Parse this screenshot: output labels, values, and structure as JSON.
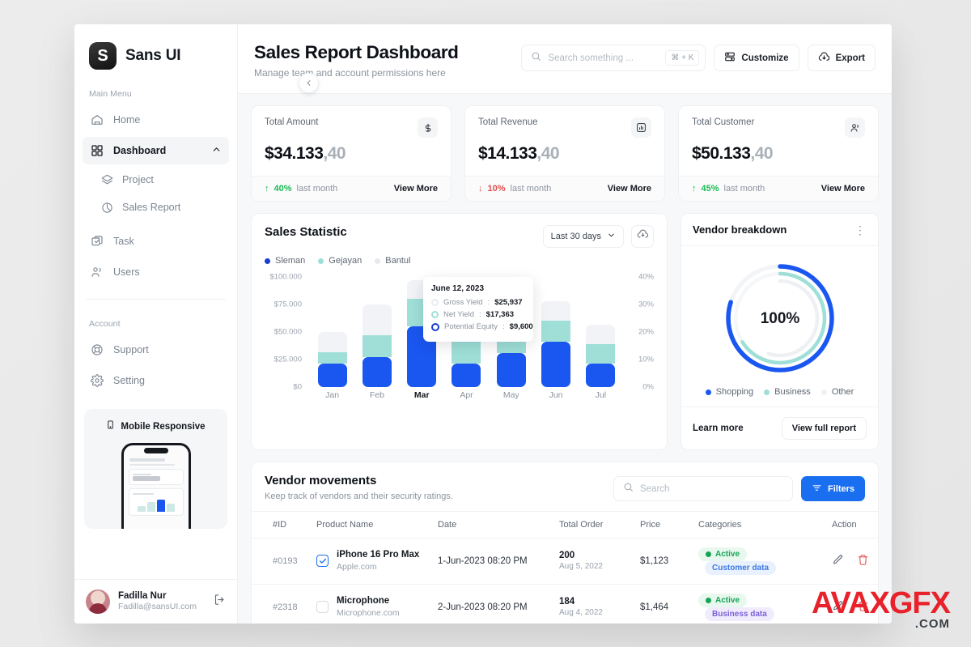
{
  "brand": {
    "logo_letter": "S",
    "name": "Sans UI"
  },
  "sidebar": {
    "main_label": "Main Menu",
    "account_label": "Account",
    "items": [
      {
        "label": "Home",
        "icon": "home-icon"
      },
      {
        "label": "Dashboard",
        "icon": "grid-icon"
      },
      {
        "label": "Project",
        "icon": "layers-icon"
      },
      {
        "label": "Sales Report",
        "icon": "pie-chart-icon"
      },
      {
        "label": "Task",
        "icon": "task-icon"
      },
      {
        "label": "Users",
        "icon": "users-icon"
      },
      {
        "label": "Support",
        "icon": "lifebuoy-icon"
      },
      {
        "label": "Setting",
        "icon": "gear-icon"
      }
    ],
    "promo": {
      "title": "Mobile Responsive"
    },
    "user": {
      "name": "Fadilla Nur",
      "email": "Fadilla@sansUI.com"
    }
  },
  "header": {
    "title": "Sales Report Dashboard",
    "subtitle": "Manage team and account permissions here",
    "search": {
      "placeholder": "Search something ...",
      "value": "",
      "shortcut": "⌘ + K"
    },
    "customize_label": "Customize",
    "export_label": "Export"
  },
  "stats": [
    {
      "label": "Total Amount",
      "value_main": "$34.133",
      "value_dec": ",40",
      "icon": "dollar-icon",
      "delta": "40%",
      "delta_dir": "up",
      "period": "last month",
      "link": "View More"
    },
    {
      "label": "Total Revenue",
      "value_main": "$14.133",
      "value_dec": ",40",
      "icon": "bar-chart-icon",
      "delta": "10%",
      "delta_dir": "down",
      "period": "last month",
      "link": "View More"
    },
    {
      "label": "Total Customer",
      "value_main": "$50.133",
      "value_dec": ",40",
      "icon": "users-icon",
      "delta": "45%",
      "delta_dir": "up",
      "period": "last month",
      "link": "View More"
    }
  ],
  "sales_statistic": {
    "title": "Sales Statistic",
    "range_label": "Last 30 days",
    "download_icon": "cloud-download-icon",
    "tooltip": {
      "date": "June 12, 2023",
      "rows": [
        {
          "label": "Gross Yield",
          "value": "$25,937",
          "color": "#e9ecf1"
        },
        {
          "label": "Net Yield",
          "value": "$17,363",
          "color": "#9fdfd8"
        },
        {
          "label": "Potential Equity",
          "value": "$9,600",
          "color": "#1a3fd0"
        }
      ]
    }
  },
  "chart_data": {
    "type": "bar",
    "title": "Sales Statistic",
    "stacked": true,
    "categories": [
      "Jan",
      "Feb",
      "Mar",
      "Apr",
      "May",
      "Jun",
      "Jul"
    ],
    "highlight_category": "Mar",
    "series": [
      {
        "name": "Sleman",
        "color": "#1a56f0",
        "values": [
          21000,
          27000,
          55000,
          21000,
          31000,
          41000,
          21000
        ]
      },
      {
        "name": "Gejayan",
        "color": "#9fdfd8",
        "values": [
          11000,
          20000,
          25000,
          20000,
          11000,
          19000,
          18000
        ]
      },
      {
        "name": "Bantul",
        "color": "#f1f3f7",
        "values": [
          18000,
          28000,
          17000,
          18000,
          16000,
          18000,
          18000
        ]
      }
    ],
    "ylabel": "",
    "xlabel": "",
    "ylim": [
      0,
      100000
    ],
    "y_ticks": [
      "$0",
      "$25.000",
      "$50.000",
      "$75.000",
      "$100.000"
    ],
    "y2_ticks": [
      "0%",
      "10%",
      "20%",
      "30%",
      "40%"
    ],
    "y2lim": [
      0,
      40
    ],
    "grid": false,
    "legend_position": "top-left",
    "legend": [
      "Sleman",
      "Gejayan",
      "Bantul"
    ]
  },
  "vendor_breakdown": {
    "title": "Vendor breakdown",
    "menu_icon": "more-vertical-icon",
    "center_value": "100%",
    "legend": [
      {
        "label": "Shopping",
        "color": "#1a56f0",
        "percent": 80
      },
      {
        "label": "Business",
        "color": "#9fdfd8",
        "percent": 66
      },
      {
        "label": "Other",
        "color": "#eef0f4",
        "percent": 55
      }
    ],
    "learn_more": "Learn more",
    "view_full_report": "View full report"
  },
  "vendor_movements": {
    "title": "Vendor movements",
    "subtitle": "Keep track of vendors and their security ratings.",
    "search_placeholder": "Search",
    "search_value": "",
    "filters_label": "Filters",
    "columns": [
      "#ID",
      "Product Name",
      "Date",
      "Total Order",
      "Price",
      "Categories",
      "Action"
    ],
    "rows": [
      {
        "id": "#0193",
        "checked": true,
        "product": "iPhone 16 Pro Max",
        "site": "Apple.com",
        "date": "1-Jun-2023 08:20 PM",
        "order": "200",
        "order_date": "Aug 5, 2022",
        "price": "$1,123",
        "status": "Active",
        "category": "Customer data",
        "category_style": "blue"
      },
      {
        "id": "#2318",
        "checked": false,
        "product": "Microphone",
        "site": "Microphone.com",
        "date": "2-Jun-2023 08:20 PM",
        "order": "184",
        "order_date": "Aug 4, 2022",
        "price": "$1,464",
        "status": "Active",
        "category": "Business data",
        "category_style": "purple"
      }
    ]
  },
  "watermark": {
    "main": "AVAXGFX",
    "sub": ".COM"
  }
}
